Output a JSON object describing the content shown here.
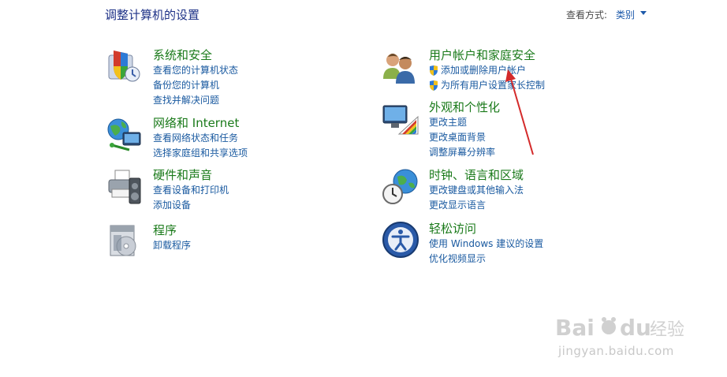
{
  "header": {
    "title": "调整计算机的设置",
    "view_by_label": "查看方式:",
    "view_by_value": "类别"
  },
  "categories": {
    "system": {
      "icon": "shield-icon",
      "title": "系统和安全",
      "links": [
        "查看您的计算机状态",
        "备份您的计算机",
        "查找并解决问题"
      ]
    },
    "network": {
      "icon": "network-icon",
      "title": "网络和 Internet",
      "links": [
        "查看网络状态和任务",
        "选择家庭组和共享选项"
      ]
    },
    "hardware": {
      "icon": "printer-icon",
      "title": "硬件和声音",
      "links": [
        "查看设备和打印机",
        "添加设备"
      ]
    },
    "programs": {
      "icon": "programs-icon",
      "title": "程序",
      "links": [
        "卸载程序"
      ]
    },
    "users": {
      "icon": "users-icon",
      "title": "用户帐户和家庭安全",
      "links": [
        "添加或删除用户帐户",
        "为所有用户设置家长控制"
      ]
    },
    "appearance": {
      "icon": "appearance-icon",
      "title": "外观和个性化",
      "links": [
        "更改主题",
        "更改桌面背景",
        "调整屏幕分辨率"
      ]
    },
    "clock": {
      "icon": "clock-globe-icon",
      "title": "时钟、语言和区域",
      "links": [
        "更改键盘或其他输入法",
        "更改显示语言"
      ]
    },
    "ease": {
      "icon": "ease-of-access-icon",
      "title": "轻松访问",
      "links": [
        "使用 Windows 建议的设置",
        "优化视频显示"
      ]
    }
  },
  "watermark": {
    "brand": "Bai du 经验",
    "url": "jingyan.baidu.com"
  },
  "colors": {
    "title_blue": "#1e3287",
    "category_green": "#1a7a1a",
    "link_blue": "#1a5aa0",
    "annotation_red": "#d42a2a"
  }
}
